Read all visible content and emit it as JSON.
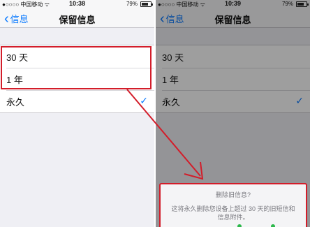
{
  "statusbar": {
    "carrier": "●○○○○ 中国移动 ᯤ",
    "time": "10:38",
    "battery": "79%"
  },
  "statusbar_right": {
    "carrier": "●○○○○ 中国移动 ᯤ",
    "time": "10:39",
    "battery": "79%"
  },
  "navbar": {
    "back_label": "信息",
    "title": "保留信息"
  },
  "options": [
    {
      "label": "30 天"
    },
    {
      "label": "1 年"
    },
    {
      "label": "永久",
      "selected": true
    }
  ],
  "dialog": {
    "title": "删除旧信息?",
    "message": "这将永久删除您设备上超过 30 天的旧短信和信息附件。"
  },
  "colors": {
    "ios_blue": "#0a7aff",
    "annotation_red": "#d31d2a",
    "confirm_green": "#2db84c"
  }
}
